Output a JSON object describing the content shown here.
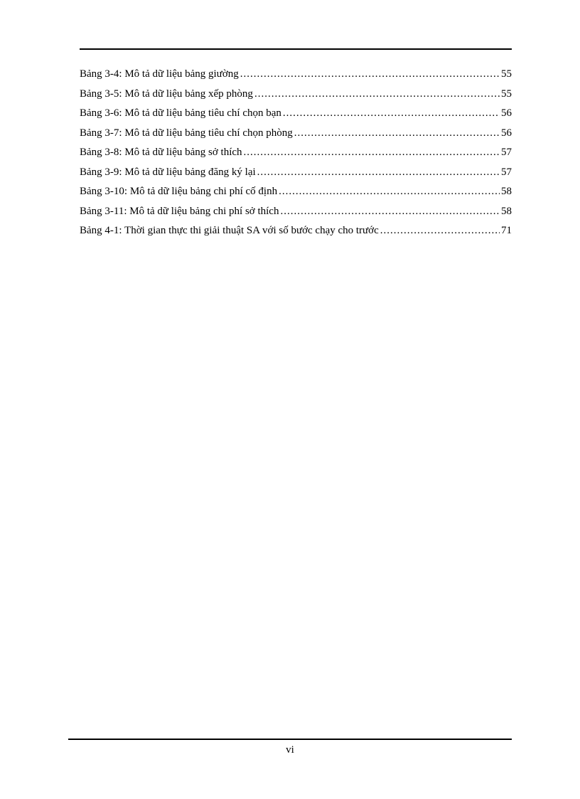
{
  "toc": {
    "entries": [
      {
        "label": "Bảng 3-4: Mô tả dữ liệu bảng giường",
        "page": "55"
      },
      {
        "label": "Bảng 3-5: Mô tả dữ liệu bảng xếp phòng",
        "page": "55"
      },
      {
        "label": "Bảng 3-6: Mô tả dữ liệu bảng tiêu chí chọn bạn",
        "page": "56"
      },
      {
        "label": "Bảng 3-7: Mô tả dữ liệu bảng tiêu chí chọn phòng",
        "page": "56"
      },
      {
        "label": "Bảng 3-8: Mô tả dữ liệu bảng sở thích",
        "page": "57"
      },
      {
        "label": "Bảng 3-9: Mô tả dữ liệu bảng đăng ký lại",
        "page": "57"
      },
      {
        "label": "Bảng 3-10: Mô tả dữ liệu bảng chi phí cố định",
        "page": "58"
      },
      {
        "label": "Bảng 3-11: Mô tả dữ liệu bảng chi phí sở thích",
        "page": "58"
      },
      {
        "label": "Bảng 4-1: Thời gian thực thi giải thuật SA với số bước chạy cho trước",
        "page": "71"
      }
    ]
  },
  "footer": {
    "page_number": "vi"
  }
}
